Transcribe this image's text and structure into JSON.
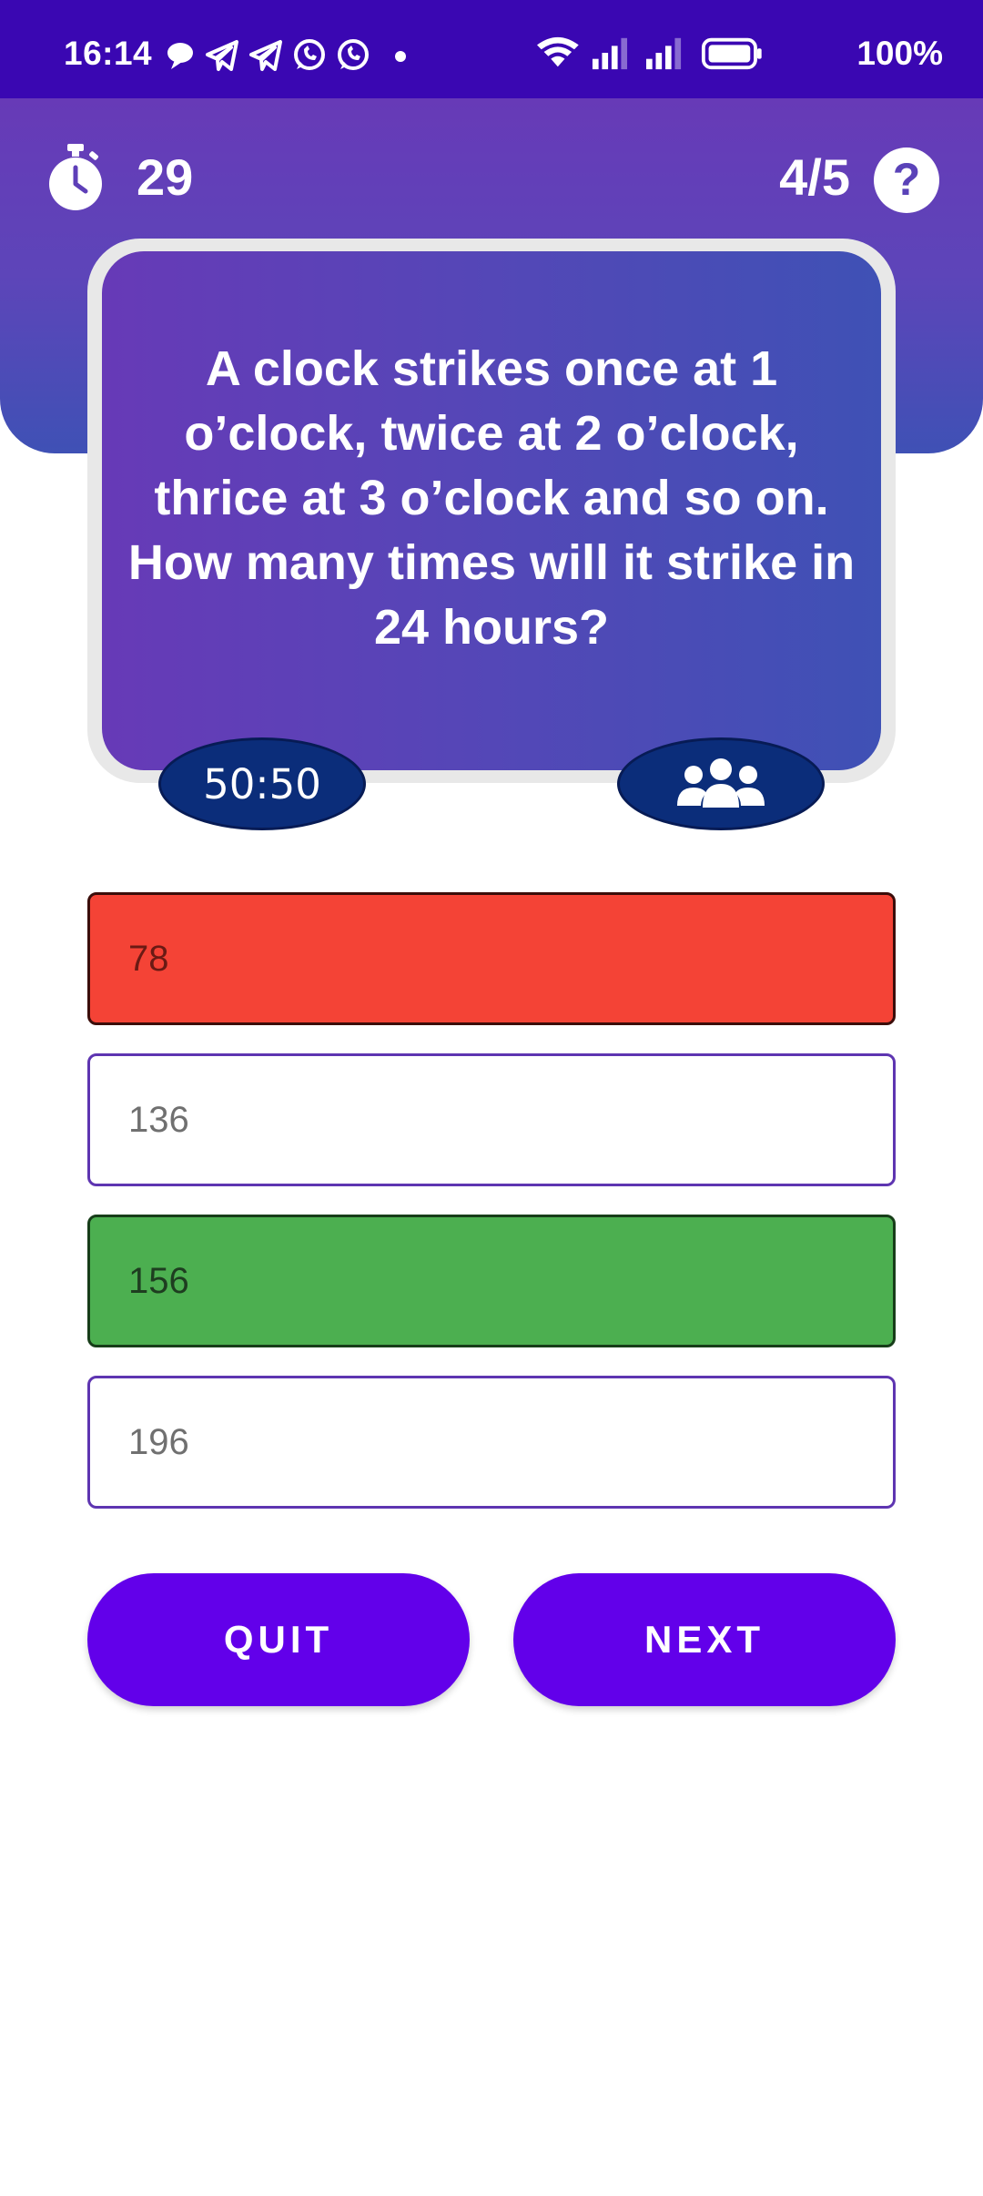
{
  "status_bar": {
    "time": "16:14",
    "battery": "100%",
    "notification_icons": [
      "chat-icon",
      "telegram-icon",
      "telegram-icon",
      "whatsapp-icon",
      "whatsapp-icon",
      "dot-icon"
    ],
    "system_icons": [
      "wifi-icon",
      "signal-icon",
      "signal-icon",
      "battery-icon"
    ]
  },
  "header": {
    "timer_value": "29",
    "progress": "4/5",
    "timer_icon": "stopwatch-icon",
    "help_icon": "question-icon"
  },
  "question": {
    "text": "A clock strikes once at 1 o’clock, twice at 2 o’clock, thrice at 3 o’clock and so on. How many times will it strike in 24 hours?"
  },
  "lifelines": {
    "fifty_fifty_label": "50:50",
    "audience_icon": "people-group-icon"
  },
  "options": [
    {
      "label": "78",
      "state": "wrong"
    },
    {
      "label": "136",
      "state": "default"
    },
    {
      "label": "156",
      "state": "correct"
    },
    {
      "label": "196",
      "state": "default"
    }
  ],
  "buttons": {
    "quit_label": "QUIT",
    "next_label": "NEXT"
  },
  "colors": {
    "status_bar": "#3a07b2",
    "header_gradient_start": "#673ab7",
    "header_gradient_end": "#3f51b5",
    "wrong": "#f44336",
    "correct": "#4caf50",
    "button": "#6200ea",
    "lifeline": "#0b2d7a"
  }
}
